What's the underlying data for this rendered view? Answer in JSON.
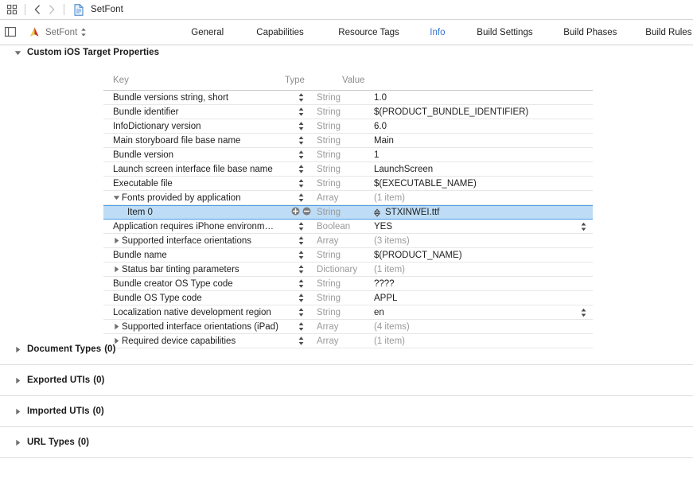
{
  "toolbar": {
    "grid_icon": "grid-icon",
    "back_icon": "chevron-left-icon",
    "forward_icon": "chevron-right-icon",
    "doc_icon": "document-icon",
    "breadcrumb_title": "SetFont"
  },
  "tabbar": {
    "panel_toggle_icon": "left-panel-toggle-icon",
    "target_icon": "xcode-target-icon",
    "target_label": "SetFont",
    "target_chevrons_icon": "chevron-up-down-icon",
    "tabs": [
      {
        "label": "General",
        "active": false
      },
      {
        "label": "Capabilities",
        "active": false
      },
      {
        "label": "Resource Tags",
        "active": false
      },
      {
        "label": "Info",
        "active": true
      },
      {
        "label": "Build Settings",
        "active": false
      },
      {
        "label": "Build Phases",
        "active": false
      },
      {
        "label": "Build Rules",
        "active": false
      }
    ],
    "active_color": "#3574cf"
  },
  "custom_section": {
    "title": "Custom iOS Target Properties",
    "expanded": true,
    "disclosure_icon": "triangle-down-icon"
  },
  "plist": {
    "columns": [
      "Key",
      "Type",
      "Value"
    ],
    "selection_color": "#bedcf5",
    "rows": [
      {
        "key": "Bundle versions string, short",
        "type": "String",
        "value": "1.0",
        "indent": 0,
        "disclosure": "none",
        "muted_value": false,
        "selected": false,
        "stepper": true,
        "value_stepper": false
      },
      {
        "key": "Bundle identifier",
        "type": "String",
        "value": "$(PRODUCT_BUNDLE_IDENTIFIER)",
        "indent": 0,
        "disclosure": "none",
        "muted_value": false,
        "selected": false,
        "stepper": true,
        "value_stepper": false
      },
      {
        "key": "InfoDictionary version",
        "type": "String",
        "value": "6.0",
        "indent": 0,
        "disclosure": "none",
        "muted_value": false,
        "selected": false,
        "stepper": true,
        "value_stepper": false
      },
      {
        "key": "Main storyboard file base name",
        "type": "String",
        "value": "Main",
        "indent": 0,
        "disclosure": "none",
        "muted_value": false,
        "selected": false,
        "stepper": true,
        "value_stepper": false
      },
      {
        "key": "Bundle version",
        "type": "String",
        "value": "1",
        "indent": 0,
        "disclosure": "none",
        "muted_value": false,
        "selected": false,
        "stepper": true,
        "value_stepper": false
      },
      {
        "key": "Launch screen interface file base name",
        "type": "String",
        "value": "LaunchScreen",
        "indent": 0,
        "disclosure": "none",
        "muted_value": false,
        "selected": false,
        "stepper": true,
        "value_stepper": false
      },
      {
        "key": "Executable file",
        "type": "String",
        "value": "$(EXECUTABLE_NAME)",
        "indent": 0,
        "disclosure": "none",
        "muted_value": false,
        "selected": false,
        "stepper": true,
        "value_stepper": false
      },
      {
        "key": "Fonts provided by application",
        "type": "Array",
        "value": "(1 item)",
        "indent": 0,
        "disclosure": "down",
        "muted_value": true,
        "selected": false,
        "stepper": true,
        "value_stepper": false
      },
      {
        "key": "Item 0",
        "type": "String",
        "value": "STXINWEI.ttf",
        "indent": 1,
        "disclosure": "none",
        "muted_value": false,
        "selected": true,
        "stepper": false,
        "value_stepper": false,
        "plus_minus": true,
        "type_stepper": true
      },
      {
        "key": "Application requires iPhone environm…",
        "type": "Boolean",
        "value": "YES",
        "indent": 0,
        "disclosure": "none",
        "muted_value": false,
        "selected": false,
        "stepper": true,
        "value_stepper": true
      },
      {
        "key": "Supported interface orientations",
        "type": "Array",
        "value": "(3 items)",
        "indent": 0,
        "disclosure": "right",
        "muted_value": true,
        "selected": false,
        "stepper": true,
        "value_stepper": false
      },
      {
        "key": "Bundle name",
        "type": "String",
        "value": "$(PRODUCT_NAME)",
        "indent": 0,
        "disclosure": "none",
        "muted_value": false,
        "selected": false,
        "stepper": true,
        "value_stepper": false
      },
      {
        "key": "Status bar tinting parameters",
        "type": "Dictionary",
        "value": "(1 item)",
        "indent": 0,
        "disclosure": "right",
        "muted_value": true,
        "selected": false,
        "stepper": true,
        "value_stepper": false
      },
      {
        "key": "Bundle creator OS Type code",
        "type": "String",
        "value": "????",
        "indent": 0,
        "disclosure": "none",
        "muted_value": false,
        "selected": false,
        "stepper": true,
        "value_stepper": false
      },
      {
        "key": "Bundle OS Type code",
        "type": "String",
        "value": "APPL",
        "indent": 0,
        "disclosure": "none",
        "muted_value": false,
        "selected": false,
        "stepper": true,
        "value_stepper": false
      },
      {
        "key": "Localization native development region",
        "type": "String",
        "value": "en",
        "indent": 0,
        "disclosure": "none",
        "muted_value": false,
        "selected": false,
        "stepper": true,
        "value_stepper": true
      },
      {
        "key": "Supported interface orientations (iPad)",
        "type": "Array",
        "value": "(4 items)",
        "indent": 0,
        "disclosure": "right",
        "muted_value": true,
        "selected": false,
        "stepper": true,
        "value_stepper": false
      },
      {
        "key": "Required device capabilities",
        "type": "Array",
        "value": "(1 item)",
        "indent": 0,
        "disclosure": "right",
        "muted_value": true,
        "selected": false,
        "stepper": true,
        "value_stepper": false
      }
    ]
  },
  "lower_sections": [
    {
      "title": "Document Types",
      "count": "(0)",
      "disclosure_icon": "triangle-right-icon"
    },
    {
      "title": "Exported UTIs",
      "count": "(0)",
      "disclosure_icon": "triangle-right-icon"
    },
    {
      "title": "Imported UTIs",
      "count": "(0)",
      "disclosure_icon": "triangle-right-icon"
    },
    {
      "title": "URL Types",
      "count": "(0)",
      "disclosure_icon": "triangle-right-icon"
    }
  ]
}
